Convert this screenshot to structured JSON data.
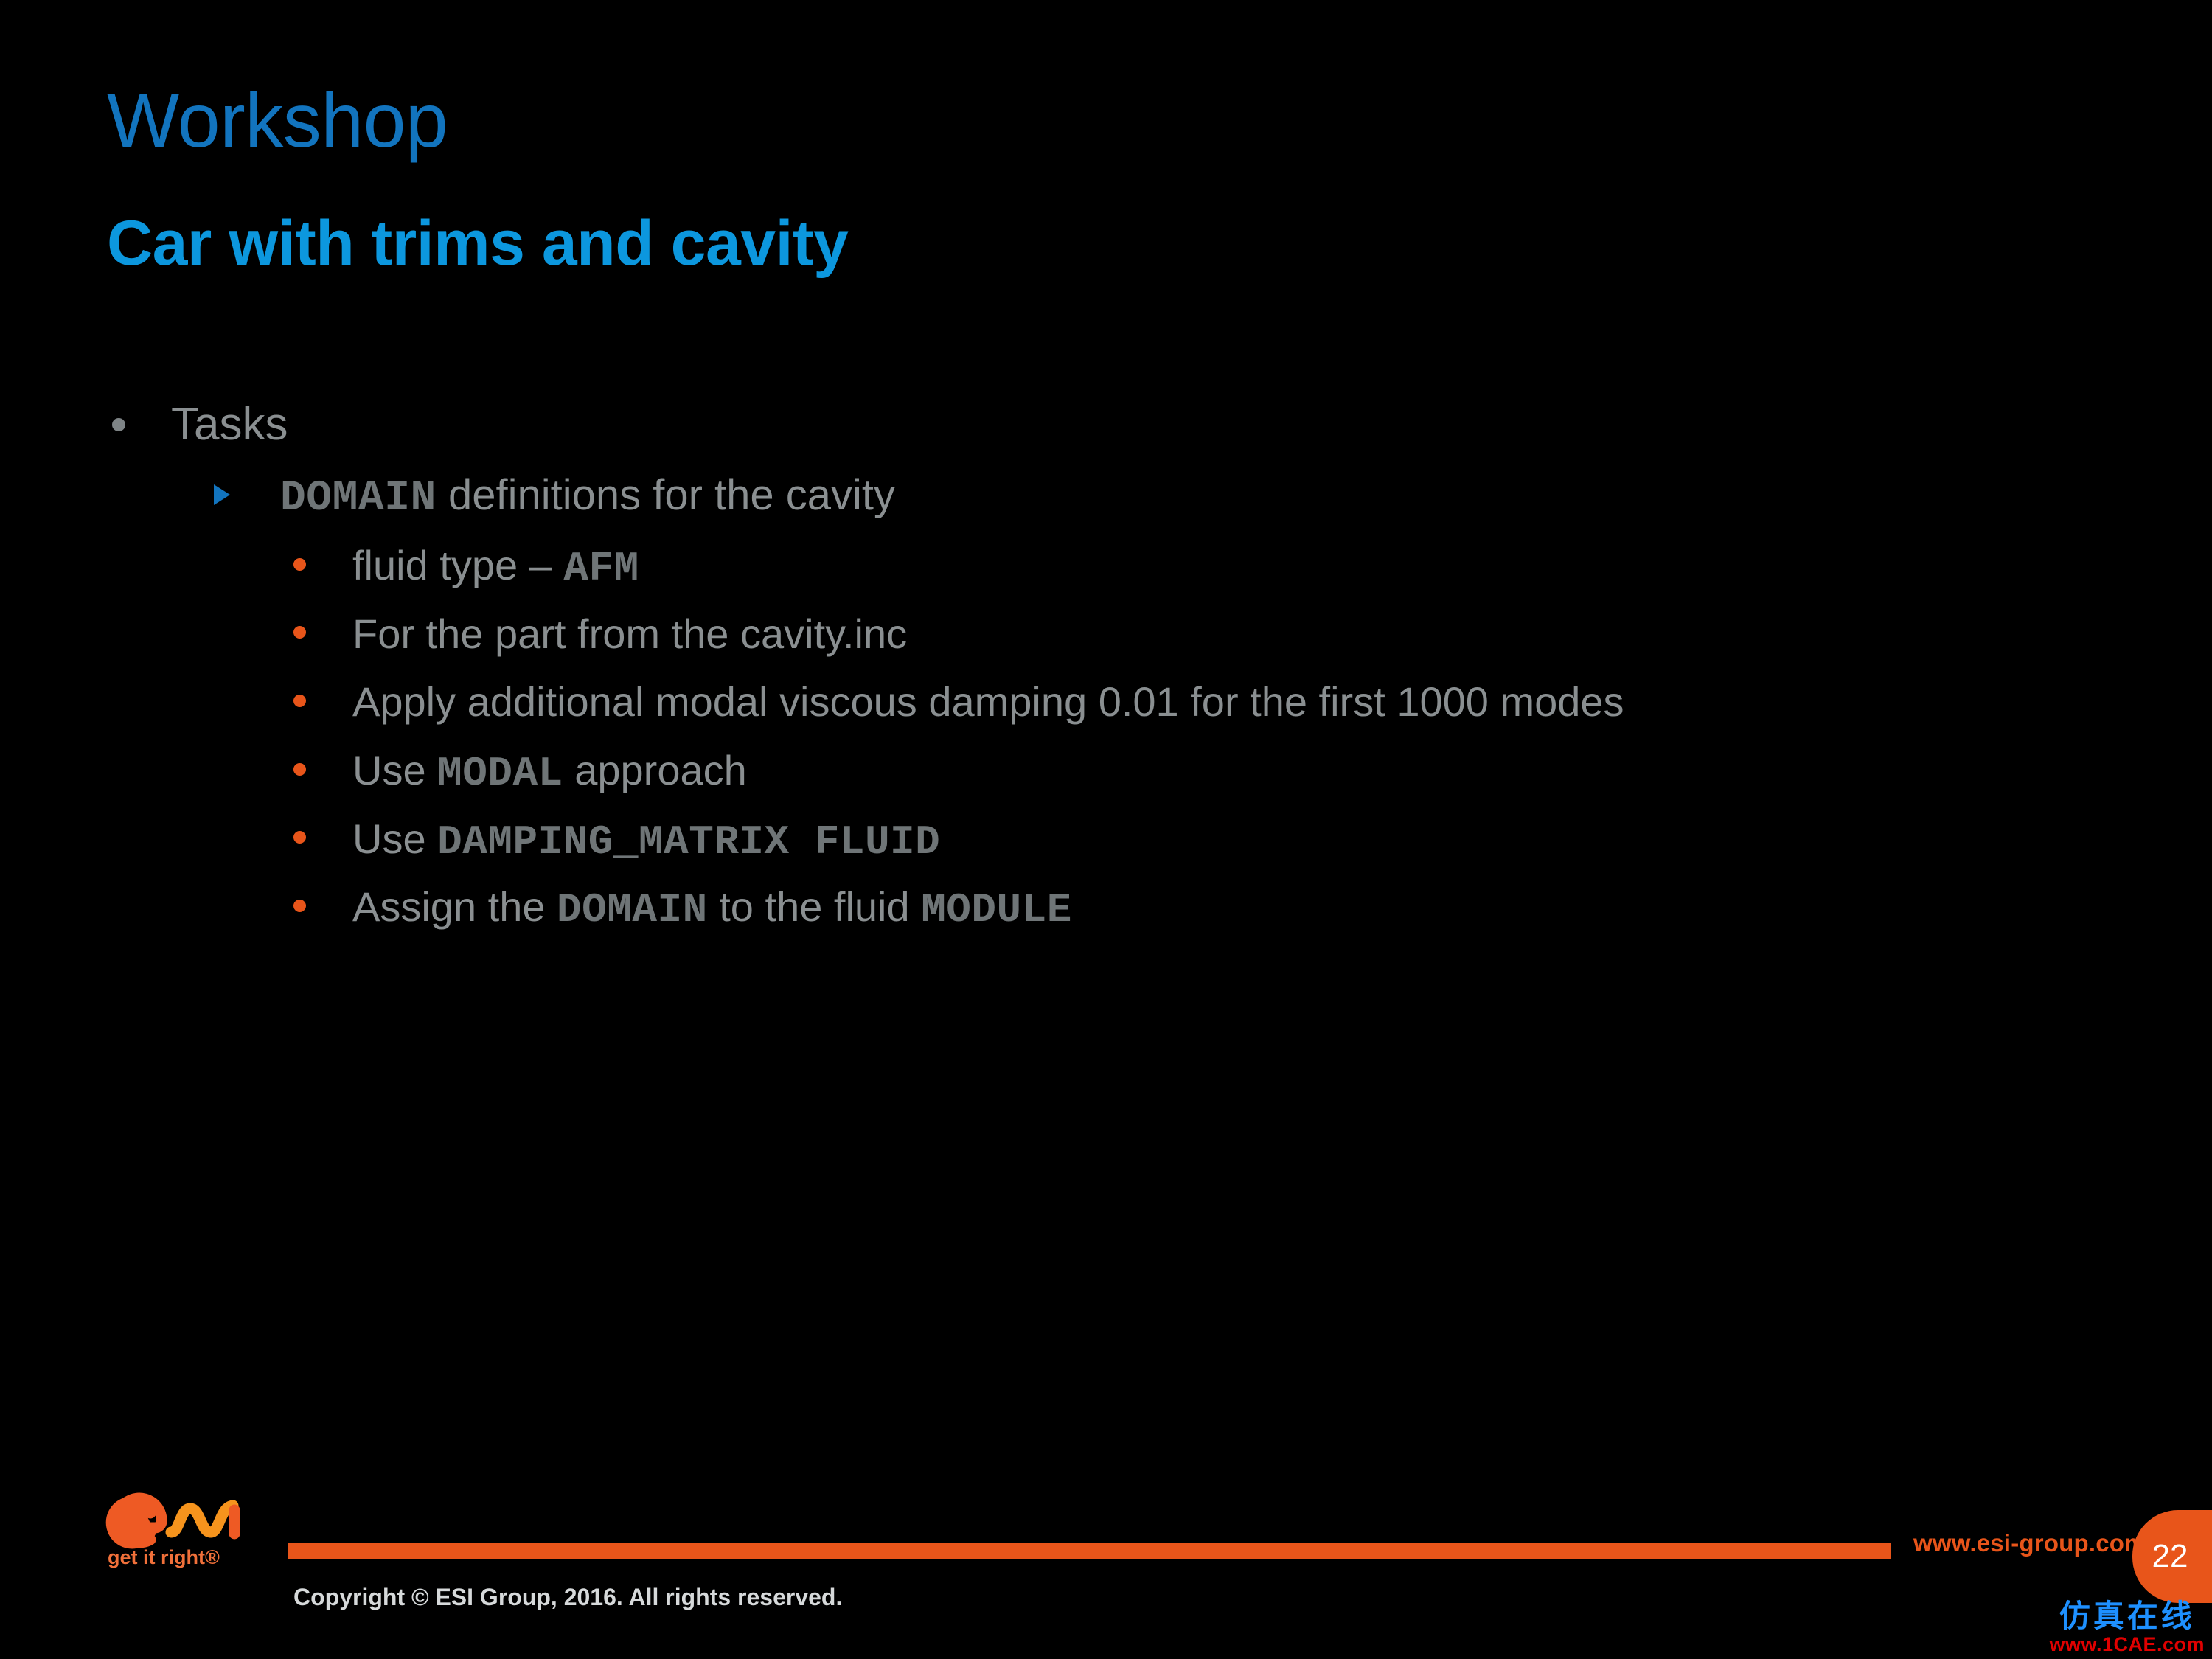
{
  "slide": {
    "title": "Workshop",
    "subtitle": "Car with trims and cavity",
    "background_color": "#000000",
    "title_color": "#1274BE",
    "subtitle_color": "#0C97DE",
    "body_text_color": "#8A8F91",
    "accent_color": "#E8551A"
  },
  "content": {
    "level1": {
      "text": "Tasks"
    },
    "level2": {
      "code": "DOMAIN",
      "text": " definitions for the cavity"
    },
    "level3": [
      {
        "pre": "fluid type – ",
        "code": "AFM",
        "post": ""
      },
      {
        "pre": "For the part from the cavity.inc",
        "code": "",
        "post": ""
      },
      {
        "pre": "Apply additional modal viscous damping 0.01 for the first 1000 modes",
        "code": "",
        "post": ""
      },
      {
        "pre": "Use ",
        "code": "MODAL",
        "post": " approach"
      },
      {
        "pre": "Use ",
        "code": "DAMPING_MATRIX FLUID",
        "post": ""
      },
      {
        "pre": "Assign the ",
        "code": "DOMAIN",
        "post": " to the fluid ",
        "code2": "MODULE"
      }
    ]
  },
  "footer": {
    "logo_text": "esi",
    "logo_tagline": "get it right®",
    "url": "www.esi-group.com",
    "page_number": "22",
    "copyright": "Copyright © ESI Group, 2016. All rights reserved."
  },
  "watermark": {
    "chinese": "仿真在线",
    "site": "www.1CAE.com"
  }
}
